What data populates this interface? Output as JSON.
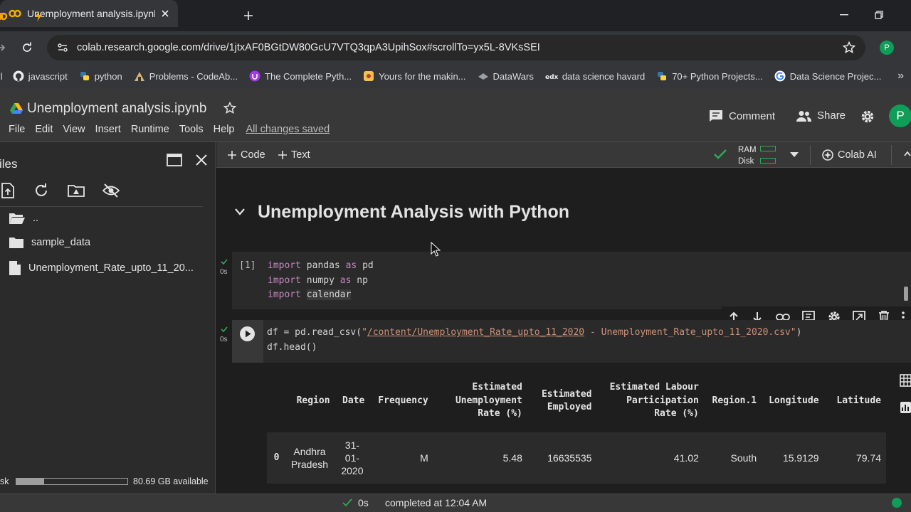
{
  "browser": {
    "active_tab_title": "Unemployment analysis.ipynb",
    "url": "colab.research.google.com/drive/1jtxAF0BGtDW80GcU7VTQ3qpA3UpihSox#scrollTo=yx5L-8VKsSEI",
    "profile_initial": "P",
    "bookmarks": [
      {
        "label": "javascript",
        "icon": "github-icon"
      },
      {
        "label": "python",
        "icon": "python-icon"
      },
      {
        "label": "Problems - CodeAb...",
        "icon": "codeabbey-icon"
      },
      {
        "label": "The Complete Pyth...",
        "icon": "udemy-icon"
      },
      {
        "label": "Yours for the makin...",
        "icon": "bookmark-favicon"
      },
      {
        "label": "DataWars",
        "icon": "datawars-icon"
      },
      {
        "label": "data science havard",
        "icon": "edx-icon"
      },
      {
        "label": "70+ Python Projects...",
        "icon": "python-icon"
      },
      {
        "label": "Data Science Projec...",
        "icon": "google-icon"
      }
    ]
  },
  "colab": {
    "notebook_title": "Unemployment analysis.ipynb",
    "menu": [
      "File",
      "Edit",
      "View",
      "Insert",
      "Runtime",
      "Tools",
      "Help"
    ],
    "save_status": "All changes saved",
    "comment_label": "Comment",
    "share_label": "Share",
    "avatar_initial": "P",
    "toolbar": {
      "add_code": "Code",
      "add_text": "Text",
      "ram_label": "RAM",
      "disk_label": "Disk",
      "colab_ai": "Colab AI"
    }
  },
  "sidebar": {
    "title": "iles",
    "files": [
      {
        "name": "..",
        "type": "folder-open"
      },
      {
        "name": "sample_data",
        "type": "folder"
      },
      {
        "name": "Unemployment_Rate_upto_11_20...",
        "type": "file"
      }
    ],
    "disk_label": "sk",
    "disk_available": "80.69 GB available",
    "disk_used_fraction": 0.25
  },
  "notebook": {
    "section_title": "Unemployment Analysis with Python",
    "cell1": {
      "exec_count": "[1]",
      "time": "0s"
    },
    "cell2": {
      "time": "0s"
    }
  },
  "dataframe": {
    "columns": [
      "",
      "Region",
      "Date",
      "Frequency",
      "Estimated Unemployment Rate (%)",
      "Estimated Employed",
      "Estimated Labour Participation Rate (%)",
      "Region.1",
      "Longitude",
      "Latitude"
    ],
    "rows": [
      [
        "0",
        "Andhra Pradesh",
        "31-01-2020",
        "M",
        "5.48",
        "16635535",
        "41.02",
        "South",
        "15.9129",
        "79.74"
      ]
    ]
  },
  "status": {
    "time": "0s",
    "message": "completed at 12:04 AM"
  },
  "colors": {
    "colab_orange": "#f9ab00",
    "check_green": "#34a853",
    "status_dot": "#0f9d58"
  }
}
